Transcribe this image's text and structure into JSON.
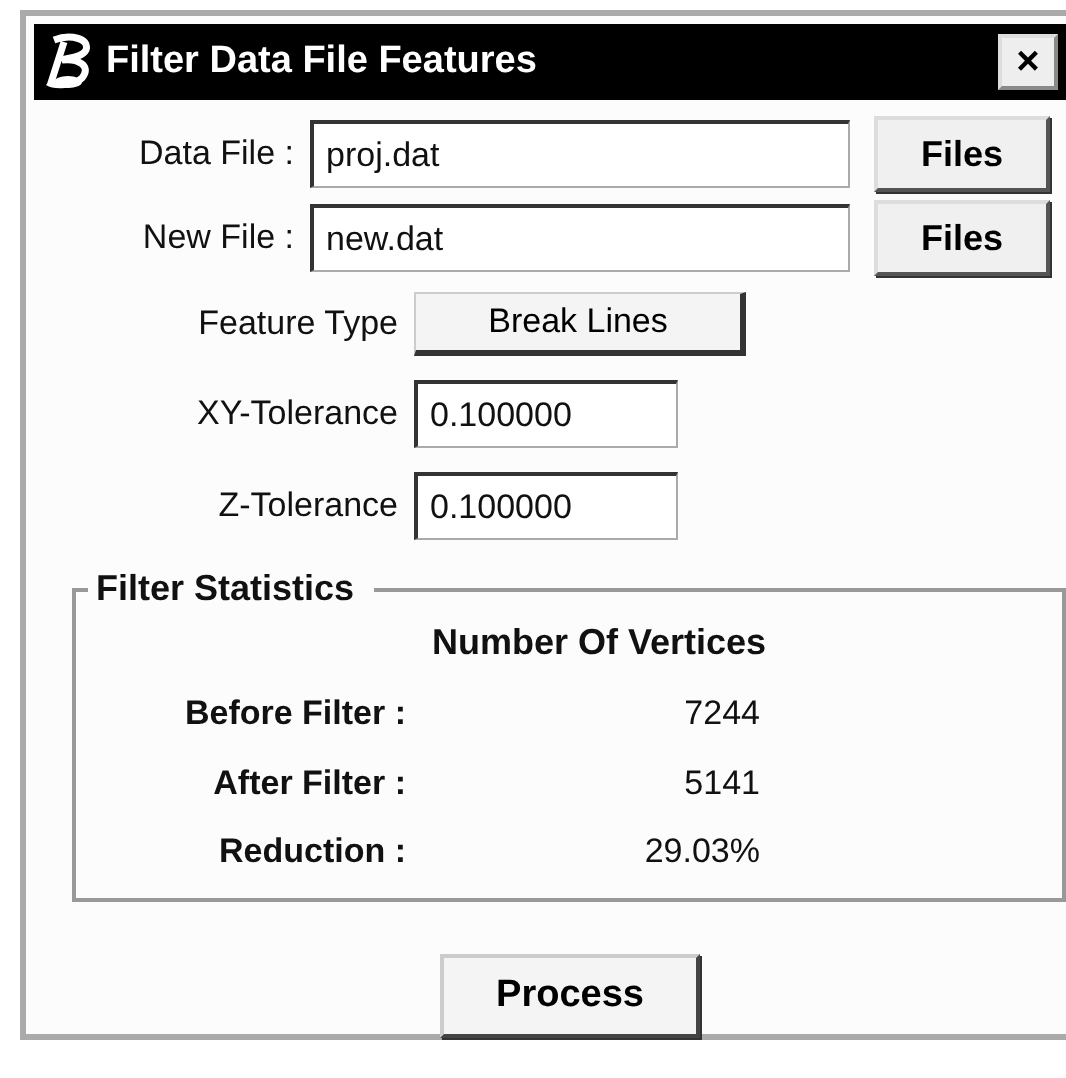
{
  "window": {
    "title": "Filter Data File Features",
    "close": "×"
  },
  "file_rows": [
    {
      "label": "Data File :",
      "value": "proj.dat",
      "button": "Files"
    },
    {
      "label": "New File :",
      "value": "new.dat",
      "button": "Files"
    }
  ],
  "feature_type": {
    "label": "Feature Type",
    "value": "Break Lines"
  },
  "tolerances": [
    {
      "label": "XY-Tolerance",
      "value": "0.100000"
    },
    {
      "label": "Z-Tolerance",
      "value": "0.100000"
    }
  ],
  "statistics": {
    "title": "Filter Statistics",
    "heading": "Number Of Vertices",
    "rows": [
      {
        "label": "Before Filter :",
        "value": "7244"
      },
      {
        "label": "After Filter :",
        "value": "5141"
      },
      {
        "label": "Reduction :",
        "value": "29.03%"
      }
    ]
  },
  "buttons": [
    "Process"
  ]
}
